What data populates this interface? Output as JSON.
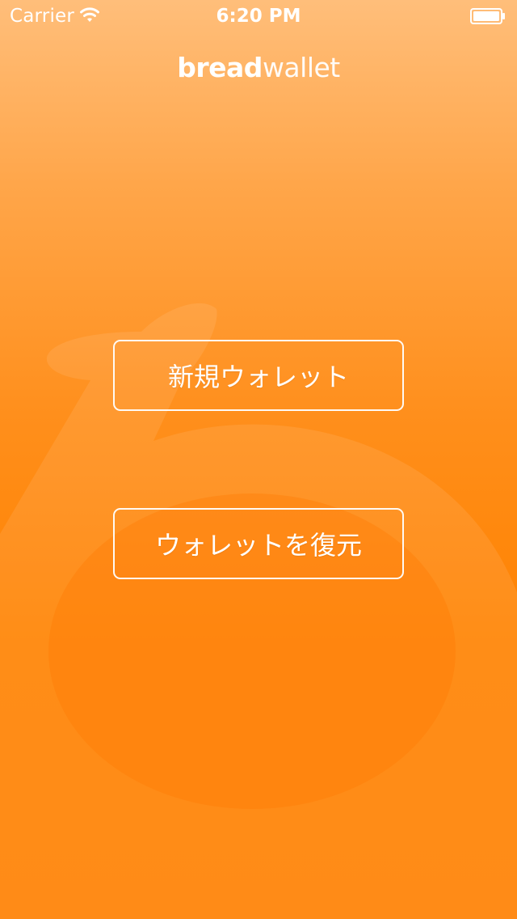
{
  "status_bar": {
    "carrier": "Carrier",
    "time": "6:20 PM",
    "wifi_icon": "wifi-icon",
    "battery_icon": "battery-full-icon"
  },
  "logo": {
    "bold_part": "bread",
    "light_part": "wallet"
  },
  "actions": {
    "new_wallet_label": "新規ウォレット",
    "restore_wallet_label": "ウォレットを復元"
  },
  "colors": {
    "background_top": "#ffbe7a",
    "background_bottom": "#ff8000",
    "text": "#ffffff"
  }
}
